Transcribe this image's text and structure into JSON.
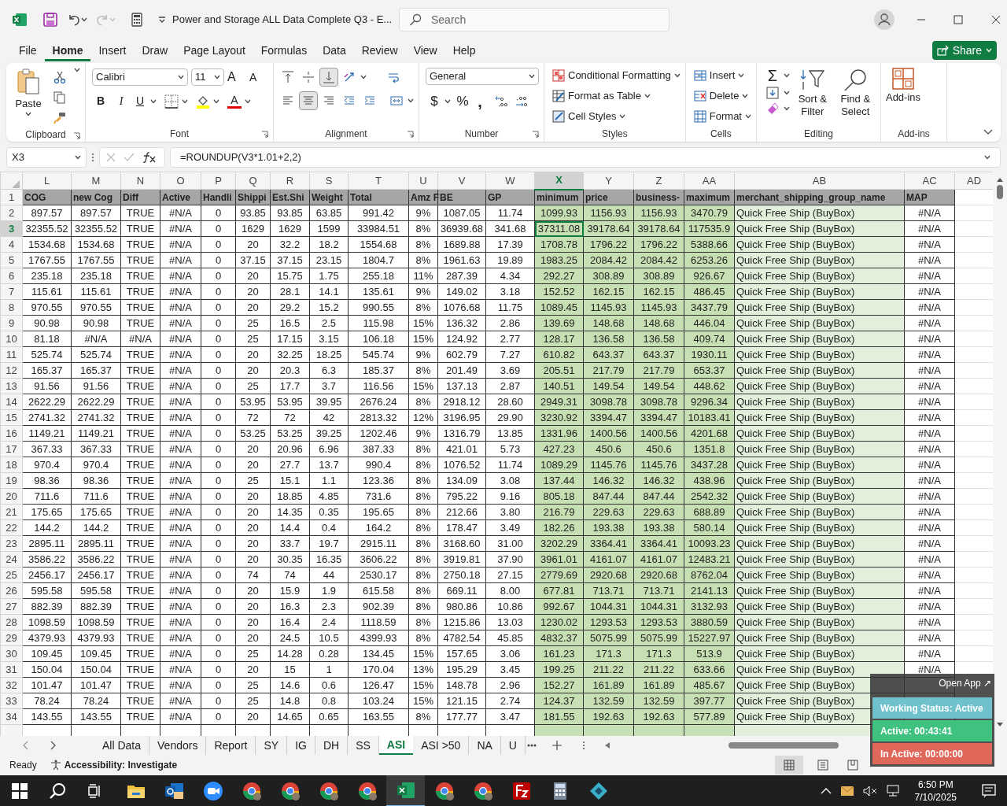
{
  "title_bar": {
    "title": "Power and Storage ALL Data Complete Q3 - E...",
    "search_placeholder": "Search"
  },
  "menu_tabs": [
    {
      "label": "File",
      "selected": false
    },
    {
      "label": "Home",
      "selected": true
    },
    {
      "label": "Insert",
      "selected": false
    },
    {
      "label": "Draw",
      "selected": false
    },
    {
      "label": "Page Layout",
      "selected": false
    },
    {
      "label": "Formulas",
      "selected": false
    },
    {
      "label": "Data",
      "selected": false
    },
    {
      "label": "Review",
      "selected": false
    },
    {
      "label": "View",
      "selected": false
    },
    {
      "label": "Help",
      "selected": false
    }
  ],
  "share": "Share",
  "ribbon": {
    "paste": "Paste",
    "font_name": "Calibri",
    "font_size": "11",
    "grow_font": "A",
    "shrink_font": "A",
    "bold": "B",
    "italic": "I",
    "underline": "U",
    "font_color": "A",
    "number_format": "General",
    "currency": "$",
    "percent": "%",
    "comma": ",",
    "conditional_formatting": "Conditional Formatting",
    "format_as_table": "Format as Table",
    "cell_styles": "Cell Styles",
    "insert": "Insert",
    "delete": "Delete",
    "format": "Format",
    "autosum": "Σ",
    "sort_filter": "Sort & Filter",
    "find_select": "Find & Select",
    "add_ins": "Add-ins",
    "groups": [
      "Clipboard",
      "Font",
      "Alignment",
      "Number",
      "Styles",
      "Cells",
      "Editing",
      "Add-ins"
    ]
  },
  "formula_bar": {
    "name_box": "X3",
    "formula": "=ROUNDUP(V3*1.01+2,2)"
  },
  "sheet": {
    "columns": [
      {
        "label": "L",
        "selected": false
      },
      {
        "label": "M",
        "selected": false
      },
      {
        "label": "N",
        "selected": false
      },
      {
        "label": "O",
        "selected": false
      },
      {
        "label": "P",
        "selected": false
      },
      {
        "label": "Q",
        "selected": false
      },
      {
        "label": "R",
        "selected": false
      },
      {
        "label": "S",
        "selected": false
      },
      {
        "label": "T",
        "selected": false
      },
      {
        "label": "U",
        "selected": false
      },
      {
        "label": "V",
        "selected": false
      },
      {
        "label": "W",
        "selected": false
      },
      {
        "label": "X",
        "selected": true
      },
      {
        "label": "Y",
        "selected": false
      },
      {
        "label": "Z",
        "selected": false
      },
      {
        "label": "AA",
        "selected": false
      },
      {
        "label": "AB",
        "selected": false
      },
      {
        "label": "AC",
        "selected": false
      },
      {
        "label": "AD",
        "selected": false
      }
    ],
    "rows": [
      {
        "number": "1",
        "kind": "header",
        "selected": false,
        "cells": [
          "COG",
          "new Cog",
          "Diff",
          "Active",
          "Handli",
          "Shippi",
          "Est.Shi",
          "Weight",
          "Total",
          "Amz F",
          "BE",
          "GP",
          "minimum",
          "price",
          "business-",
          "maximum",
          "merchant_shipping_group_name",
          "MAP"
        ]
      },
      {
        "number": "2",
        "kind": "data",
        "selected": false,
        "cells": [
          "897.57",
          "897.57",
          "TRUE",
          "#N/A",
          "0",
          "93.85",
          "93.85",
          "63.85",
          "991.42",
          "9%",
          "1087.05",
          "11.74",
          "1099.93",
          "1156.93",
          "1156.93",
          "3470.79",
          "Quick Free Ship (BuyBox)",
          "#N/A"
        ]
      },
      {
        "number": "3",
        "kind": "data",
        "selected": true,
        "cells": [
          "32355.52",
          "32355.52",
          "TRUE",
          "#N/A",
          "0",
          "1629",
          "1629",
          "1599",
          "33984.51",
          "8%",
          "36939.68",
          "341.68",
          "37311.08",
          "39178.64",
          "39178.64",
          "117535.9",
          "Quick Free Ship (BuyBox)",
          "#N/A"
        ]
      },
      {
        "number": "4",
        "kind": "data",
        "selected": false,
        "cells": [
          "1534.68",
          "1534.68",
          "TRUE",
          "#N/A",
          "0",
          "20",
          "32.2",
          "18.2",
          "1554.68",
          "8%",
          "1689.88",
          "17.39",
          "1708.78",
          "1796.22",
          "1796.22",
          "5388.66",
          "Quick Free Ship (BuyBox)",
          "#N/A"
        ]
      },
      {
        "number": "5",
        "kind": "data",
        "selected": false,
        "cells": [
          "1767.55",
          "1767.55",
          "TRUE",
          "#N/A",
          "0",
          "37.15",
          "37.15",
          "23.15",
          "1804.7",
          "8%",
          "1961.63",
          "19.89",
          "1983.25",
          "2084.42",
          "2084.42",
          "6253.26",
          "Quick Free Ship (BuyBox)",
          "#N/A"
        ]
      },
      {
        "number": "6",
        "kind": "data",
        "selected": false,
        "cells": [
          "235.18",
          "235.18",
          "TRUE",
          "#N/A",
          "0",
          "20",
          "15.75",
          "1.75",
          "255.18",
          "11%",
          "287.39",
          "4.34",
          "292.27",
          "308.89",
          "308.89",
          "926.67",
          "Quick Free Ship (BuyBox)",
          "#N/A"
        ]
      },
      {
        "number": "7",
        "kind": "data",
        "selected": false,
        "cells": [
          "115.61",
          "115.61",
          "TRUE",
          "#N/A",
          "0",
          "20",
          "28.1",
          "14.1",
          "135.61",
          "9%",
          "149.02",
          "3.18",
          "152.52",
          "162.15",
          "162.15",
          "486.45",
          "Quick Free Ship (BuyBox)",
          "#N/A"
        ]
      },
      {
        "number": "8",
        "kind": "data",
        "selected": false,
        "cells": [
          "970.55",
          "970.55",
          "TRUE",
          "#N/A",
          "0",
          "20",
          "29.2",
          "15.2",
          "990.55",
          "8%",
          "1076.68",
          "11.75",
          "1089.45",
          "1145.93",
          "1145.93",
          "3437.79",
          "Quick Free Ship (BuyBox)",
          "#N/A"
        ]
      },
      {
        "number": "9",
        "kind": "data",
        "selected": false,
        "cells": [
          "90.98",
          "90.98",
          "TRUE",
          "#N/A",
          "0",
          "25",
          "16.5",
          "2.5",
          "115.98",
          "15%",
          "136.32",
          "2.86",
          "139.69",
          "148.68",
          "148.68",
          "446.04",
          "Quick Free Ship (BuyBox)",
          "#N/A"
        ]
      },
      {
        "number": "10",
        "kind": "data",
        "selected": false,
        "cells": [
          "81.18",
          "#N/A",
          "#N/A",
          "#N/A",
          "0",
          "25",
          "17.15",
          "3.15",
          "106.18",
          "15%",
          "124.92",
          "2.77",
          "128.17",
          "136.58",
          "136.58",
          "409.74",
          "Quick Free Ship (BuyBox)",
          "#N/A"
        ]
      },
      {
        "number": "11",
        "kind": "data",
        "selected": false,
        "cells": [
          "525.74",
          "525.74",
          "TRUE",
          "#N/A",
          "0",
          "20",
          "32.25",
          "18.25",
          "545.74",
          "9%",
          "602.79",
          "7.27",
          "610.82",
          "643.37",
          "643.37",
          "1930.11",
          "Quick Free Ship (BuyBox)",
          "#N/A"
        ]
      },
      {
        "number": "12",
        "kind": "data",
        "selected": false,
        "cells": [
          "165.37",
          "165.37",
          "TRUE",
          "#N/A",
          "0",
          "20",
          "20.3",
          "6.3",
          "185.37",
          "8%",
          "201.49",
          "3.69",
          "205.51",
          "217.79",
          "217.79",
          "653.37",
          "Quick Free Ship (BuyBox)",
          "#N/A"
        ]
      },
      {
        "number": "13",
        "kind": "data",
        "selected": false,
        "cells": [
          "91.56",
          "91.56",
          "TRUE",
          "#N/A",
          "0",
          "25",
          "17.7",
          "3.7",
          "116.56",
          "15%",
          "137.13",
          "2.87",
          "140.51",
          "149.54",
          "149.54",
          "448.62",
          "Quick Free Ship (BuyBox)",
          "#N/A"
        ]
      },
      {
        "number": "14",
        "kind": "data",
        "selected": false,
        "cells": [
          "2622.29",
          "2622.29",
          "TRUE",
          "#N/A",
          "0",
          "53.95",
          "53.95",
          "39.95",
          "2676.24",
          "8%",
          "2918.12",
          "28.60",
          "2949.31",
          "3098.78",
          "3098.78",
          "9296.34",
          "Quick Free Ship (BuyBox)",
          "#N/A"
        ]
      },
      {
        "number": "15",
        "kind": "data",
        "selected": false,
        "cells": [
          "2741.32",
          "2741.32",
          "TRUE",
          "#N/A",
          "0",
          "72",
          "72",
          "42",
          "2813.32",
          "12%",
          "3196.95",
          "29.90",
          "3230.92",
          "3394.47",
          "3394.47",
          "10183.41",
          "Quick Free Ship (BuyBox)",
          "#N/A"
        ]
      },
      {
        "number": "16",
        "kind": "data",
        "selected": false,
        "cells": [
          "1149.21",
          "1149.21",
          "TRUE",
          "#N/A",
          "0",
          "53.25",
          "53.25",
          "39.25",
          "1202.46",
          "9%",
          "1316.79",
          "13.85",
          "1331.96",
          "1400.56",
          "1400.56",
          "4201.68",
          "Quick Free Ship (BuyBox)",
          "#N/A"
        ]
      },
      {
        "number": "17",
        "kind": "data",
        "selected": false,
        "cells": [
          "367.33",
          "367.33",
          "TRUE",
          "#N/A",
          "0",
          "20",
          "20.96",
          "6.96",
          "387.33",
          "8%",
          "421.01",
          "5.73",
          "427.23",
          "450.6",
          "450.6",
          "1351.8",
          "Quick Free Ship (BuyBox)",
          "#N/A"
        ]
      },
      {
        "number": "18",
        "kind": "data",
        "selected": false,
        "cells": [
          "970.4",
          "970.4",
          "TRUE",
          "#N/A",
          "0",
          "20",
          "27.7",
          "13.7",
          "990.4",
          "8%",
          "1076.52",
          "11.74",
          "1089.29",
          "1145.76",
          "1145.76",
          "3437.28",
          "Quick Free Ship (BuyBox)",
          "#N/A"
        ]
      },
      {
        "number": "19",
        "kind": "data",
        "selected": false,
        "cells": [
          "98.36",
          "98.36",
          "TRUE",
          "#N/A",
          "0",
          "25",
          "15.1",
          "1.1",
          "123.36",
          "8%",
          "134.09",
          "3.08",
          "137.44",
          "146.32",
          "146.32",
          "438.96",
          "Quick Free Ship (BuyBox)",
          "#N/A"
        ]
      },
      {
        "number": "20",
        "kind": "data",
        "selected": false,
        "cells": [
          "711.6",
          "711.6",
          "TRUE",
          "#N/A",
          "0",
          "20",
          "18.85",
          "4.85",
          "731.6",
          "8%",
          "795.22",
          "9.16",
          "805.18",
          "847.44",
          "847.44",
          "2542.32",
          "Quick Free Ship (BuyBox)",
          "#N/A"
        ]
      },
      {
        "number": "21",
        "kind": "data",
        "selected": false,
        "cells": [
          "175.65",
          "175.65",
          "TRUE",
          "#N/A",
          "0",
          "20",
          "14.35",
          "0.35",
          "195.65",
          "8%",
          "212.66",
          "3.80",
          "216.79",
          "229.63",
          "229.63",
          "688.89",
          "Quick Free Ship (BuyBox)",
          "#N/A"
        ]
      },
      {
        "number": "22",
        "kind": "data",
        "selected": false,
        "cells": [
          "144.2",
          "144.2",
          "TRUE",
          "#N/A",
          "0",
          "20",
          "14.4",
          "0.4",
          "164.2",
          "8%",
          "178.47",
          "3.49",
          "182.26",
          "193.38",
          "193.38",
          "580.14",
          "Quick Free Ship (BuyBox)",
          "#N/A"
        ]
      },
      {
        "number": "23",
        "kind": "data",
        "selected": false,
        "cells": [
          "2895.11",
          "2895.11",
          "TRUE",
          "#N/A",
          "0",
          "20",
          "33.7",
          "19.7",
          "2915.11",
          "8%",
          "3168.60",
          "31.00",
          "3202.29",
          "3364.41",
          "3364.41",
          "10093.23",
          "Quick Free Ship (BuyBox)",
          "#N/A"
        ]
      },
      {
        "number": "24",
        "kind": "data",
        "selected": false,
        "cells": [
          "3586.22",
          "3586.22",
          "TRUE",
          "#N/A",
          "0",
          "20",
          "30.35",
          "16.35",
          "3606.22",
          "8%",
          "3919.81",
          "37.90",
          "3961.01",
          "4161.07",
          "4161.07",
          "12483.21",
          "Quick Free Ship (BuyBox)",
          "#N/A"
        ]
      },
      {
        "number": "25",
        "kind": "data",
        "selected": false,
        "cells": [
          "2456.17",
          "2456.17",
          "TRUE",
          "#N/A",
          "0",
          "74",
          "74",
          "44",
          "2530.17",
          "8%",
          "2750.18",
          "27.15",
          "2779.69",
          "2920.68",
          "2920.68",
          "8762.04",
          "Quick Free Ship (BuyBox)",
          "#N/A"
        ]
      },
      {
        "number": "26",
        "kind": "data",
        "selected": false,
        "cells": [
          "595.58",
          "595.58",
          "TRUE",
          "#N/A",
          "0",
          "20",
          "15.9",
          "1.9",
          "615.58",
          "8%",
          "669.11",
          "8.00",
          "677.81",
          "713.71",
          "713.71",
          "2141.13",
          "Quick Free Ship (BuyBox)",
          "#N/A"
        ]
      },
      {
        "number": "27",
        "kind": "data",
        "selected": false,
        "cells": [
          "882.39",
          "882.39",
          "TRUE",
          "#N/A",
          "0",
          "20",
          "16.3",
          "2.3",
          "902.39",
          "8%",
          "980.86",
          "10.86",
          "992.67",
          "1044.31",
          "1044.31",
          "3132.93",
          "Quick Free Ship (BuyBox)",
          "#N/A"
        ]
      },
      {
        "number": "28",
        "kind": "data",
        "selected": false,
        "cells": [
          "1098.59",
          "1098.59",
          "TRUE",
          "#N/A",
          "0",
          "20",
          "16.4",
          "2.4",
          "1118.59",
          "8%",
          "1215.86",
          "13.03",
          "1230.02",
          "1293.53",
          "1293.53",
          "3880.59",
          "Quick Free Ship (BuyBox)",
          "#N/A"
        ]
      },
      {
        "number": "29",
        "kind": "data",
        "selected": false,
        "cells": [
          "4379.93",
          "4379.93",
          "TRUE",
          "#N/A",
          "0",
          "20",
          "24.5",
          "10.5",
          "4399.93",
          "8%",
          "4782.54",
          "45.85",
          "4832.37",
          "5075.99",
          "5075.99",
          "15227.97",
          "Quick Free Ship (BuyBox)",
          "#N/A"
        ]
      },
      {
        "number": "30",
        "kind": "data",
        "selected": false,
        "cells": [
          "109.45",
          "109.45",
          "TRUE",
          "#N/A",
          "0",
          "25",
          "14.28",
          "0.28",
          "134.45",
          "15%",
          "157.65",
          "3.06",
          "161.23",
          "171.3",
          "171.3",
          "513.9",
          "Quick Free Ship (BuyBox)",
          "#N/A"
        ]
      },
      {
        "number": "31",
        "kind": "data",
        "selected": false,
        "cells": [
          "150.04",
          "150.04",
          "TRUE",
          "#N/A",
          "0",
          "20",
          "15",
          "1",
          "170.04",
          "13%",
          "195.29",
          "3.45",
          "199.25",
          "211.22",
          "211.22",
          "633.66",
          "Quick Free Ship (BuyBox)",
          "#N/A"
        ]
      },
      {
        "number": "32",
        "kind": "data",
        "selected": false,
        "cells": [
          "101.47",
          "101.47",
          "TRUE",
          "#N/A",
          "0",
          "25",
          "14.6",
          "0.6",
          "126.47",
          "15%",
          "148.78",
          "2.96",
          "152.27",
          "161.89",
          "161.89",
          "485.67",
          "Quick Free Ship (BuyBox)"
        ]
      },
      {
        "number": "33",
        "kind": "data",
        "selected": false,
        "cells": [
          "78.24",
          "78.24",
          "TRUE",
          "#N/A",
          "0",
          "25",
          "14.8",
          "0.8",
          "103.24",
          "15%",
          "121.15",
          "2.74",
          "124.37",
          "132.59",
          "132.59",
          "397.77",
          "Quick Free Ship (BuyBox)"
        ]
      },
      {
        "number": "34",
        "kind": "data",
        "selected": false,
        "cells": [
          "143.55",
          "143.55",
          "TRUE",
          "#N/A",
          "0",
          "20",
          "14.65",
          "0.65",
          "163.55",
          "8%",
          "177.77",
          "3.47",
          "181.55",
          "192.63",
          "192.63",
          "577.89",
          "Quick Free Ship (BuyBox)"
        ]
      }
    ]
  },
  "sheet_tabs": [
    {
      "label": "All Data",
      "selected": false
    },
    {
      "label": "Vendors",
      "selected": false
    },
    {
      "label": "Report",
      "selected": false
    },
    {
      "label": "SY",
      "selected": false
    },
    {
      "label": "IG",
      "selected": false
    },
    {
      "label": "DH",
      "selected": false
    },
    {
      "label": "SS",
      "selected": false
    },
    {
      "label": "ASI",
      "selected": true
    },
    {
      "label": "ASI >50",
      "selected": false
    },
    {
      "label": "NA",
      "selected": false
    },
    {
      "label": "U",
      "selected": false
    }
  ],
  "status_bar": {
    "ready": "Ready",
    "accessibility": "Accessibility: Investigate"
  },
  "tracker": {
    "open_app": "Open App ↗",
    "working_status": "Working Status: Active",
    "active": "Active: 00:43:41",
    "inactive": "In Active: 00:00:00"
  },
  "taskbar": {
    "apps": [
      {
        "kind": "explorer",
        "active": false
      },
      {
        "kind": "outlook",
        "active": false
      },
      {
        "kind": "zoom",
        "active": false
      },
      {
        "kind": "chrome",
        "active": false
      },
      {
        "kind": "chrome",
        "active": false
      },
      {
        "kind": "chrome",
        "active": false
      },
      {
        "kind": "chrome",
        "active": false
      },
      {
        "kind": "excel",
        "active": true
      },
      {
        "kind": "chrome",
        "active": false
      },
      {
        "kind": "chrome",
        "active": false
      },
      {
        "kind": "filezilla",
        "active": false
      },
      {
        "kind": "calculator",
        "active": false
      },
      {
        "kind": "diamond",
        "active": false
      }
    ],
    "time": "6:50 PM",
    "date": "7/10/2025"
  }
}
